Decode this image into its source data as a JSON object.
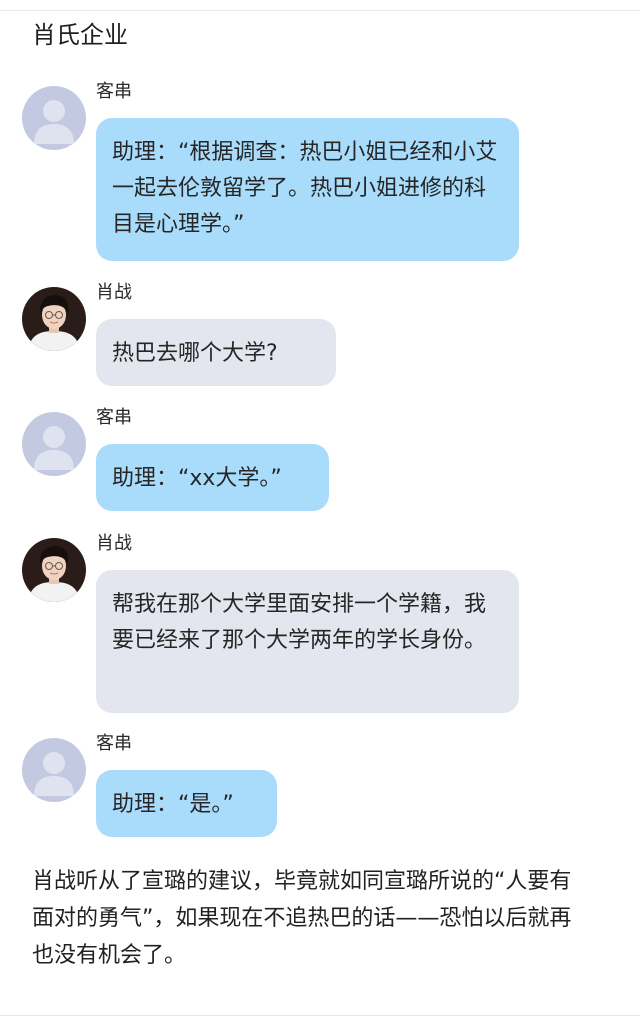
{
  "header": {
    "title": "肖氏企业"
  },
  "messages": [
    {
      "sender": "客串",
      "text": "助理：“根据调查：热巴小姐已经和小艾一起去伦敦留学了。热巴小姐进修的科目是心理学。”",
      "bubble_color": "#a9dcfb",
      "avatar": "default-person-avatar"
    },
    {
      "sender": "肖战",
      "text": "热巴去哪个大学?",
      "bubble_color": "#e3e6ee",
      "avatar": "profile-photo-avatar"
    },
    {
      "sender": "客串",
      "text": "助理：“xx大学。”",
      "bubble_color": "#a9dcfb",
      "avatar": "default-person-avatar"
    },
    {
      "sender": "肖战",
      "text": "帮我在那个大学里面安排一个学籍，我要已经来了那个大学两年的学长身份。",
      "bubble_color": "#e3e6ee",
      "avatar": "profile-photo-avatar"
    },
    {
      "sender": "客串",
      "text": "助理：“是。”",
      "bubble_color": "#a9dcfb",
      "avatar": "default-person-avatar"
    }
  ],
  "narration": "肖战听从了宣璐的建议，毕竟就如同宣璐所说的“人要有面对的勇气”，如果现在不追热巴的话——恐怕以后就再也没有机会了。"
}
